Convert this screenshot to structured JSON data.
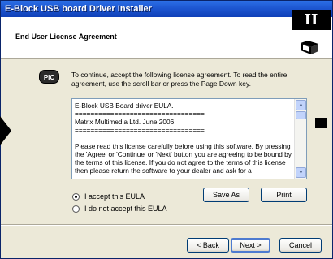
{
  "window": {
    "title": "E-Block USB board Driver Installer"
  },
  "header": {
    "heading": "End User License Agreement",
    "badge": "II"
  },
  "logo": {
    "text": "PIC"
  },
  "intro": "To continue, accept the following license agreement. To read the entire agreement, use the scroll bar or press the Page Down key.",
  "license": {
    "text": "E-Block USB Board driver EULA.\n=================================\nMatrix Multimedia Ltd. June 2006\n=================================\n\nPlease read this license carefully before using this software. By pressing the 'Agree' or 'Continue' or 'Next' button you are agreeing to be bound by the terms of this license. If you do not agree to the terms of this license then please return the software to your dealer and ask for a"
  },
  "buttons": {
    "save_as": "Save As",
    "print": "Print",
    "back": "< Back",
    "next": "Next >",
    "cancel": "Cancel"
  },
  "options": {
    "accept": "I accept this EULA",
    "decline": "I do not accept this EULA",
    "selected": "accept"
  },
  "colors": {
    "title_bar": "#1d56d1",
    "dialog_face": "#ece9d8",
    "button_border": "#003c74"
  }
}
